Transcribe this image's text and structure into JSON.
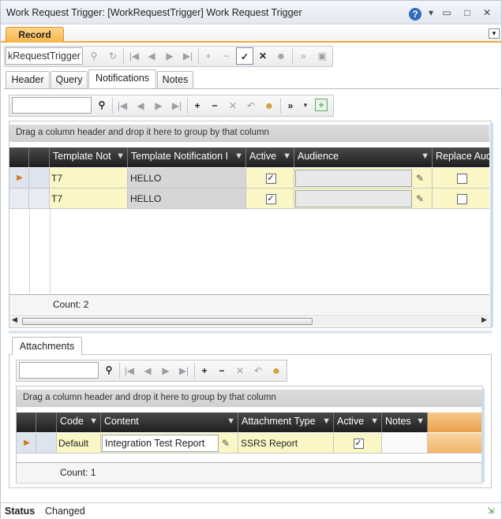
{
  "window": {
    "title": "Work Request Trigger: [WorkRequestTrigger] Work Request Trigger",
    "help": "?",
    "controls": [
      "▾",
      "▭",
      "□",
      "✕"
    ]
  },
  "record_tab": {
    "label": "Record"
  },
  "main_toolbar": {
    "record_field": "kRequestTrigger"
  },
  "tabs": [
    {
      "label": "Header"
    },
    {
      "label": "Query"
    },
    {
      "label": "Notifications"
    },
    {
      "label": "Notes"
    }
  ],
  "notifications": {
    "group_hint": "Drag a column header and drop it here to group by that column",
    "columns": [
      "Template Not",
      "Template Notification I",
      "Active",
      "Audience",
      "Replace Aud"
    ],
    "rows": [
      {
        "template": "T7",
        "name": "HELLO",
        "active": "✓",
        "replace": ""
      },
      {
        "template": "T7",
        "name": "HELLO",
        "active": "✓",
        "replace": ""
      }
    ],
    "count": "Count: 2"
  },
  "attachments": {
    "tab_label": "Attachments",
    "group_hint": "Drag a column header and drop it here to group by that column",
    "columns": [
      "Code",
      "Content",
      "Attachment Type",
      "Active",
      "Notes"
    ],
    "rows": [
      {
        "code": "Default",
        "content": "Integration Test Report",
        "type": "SSRS Report",
        "active": "✓",
        "notes": ""
      }
    ],
    "count": "Count: 1"
  },
  "status": {
    "label": "Status",
    "value": "Changed"
  }
}
